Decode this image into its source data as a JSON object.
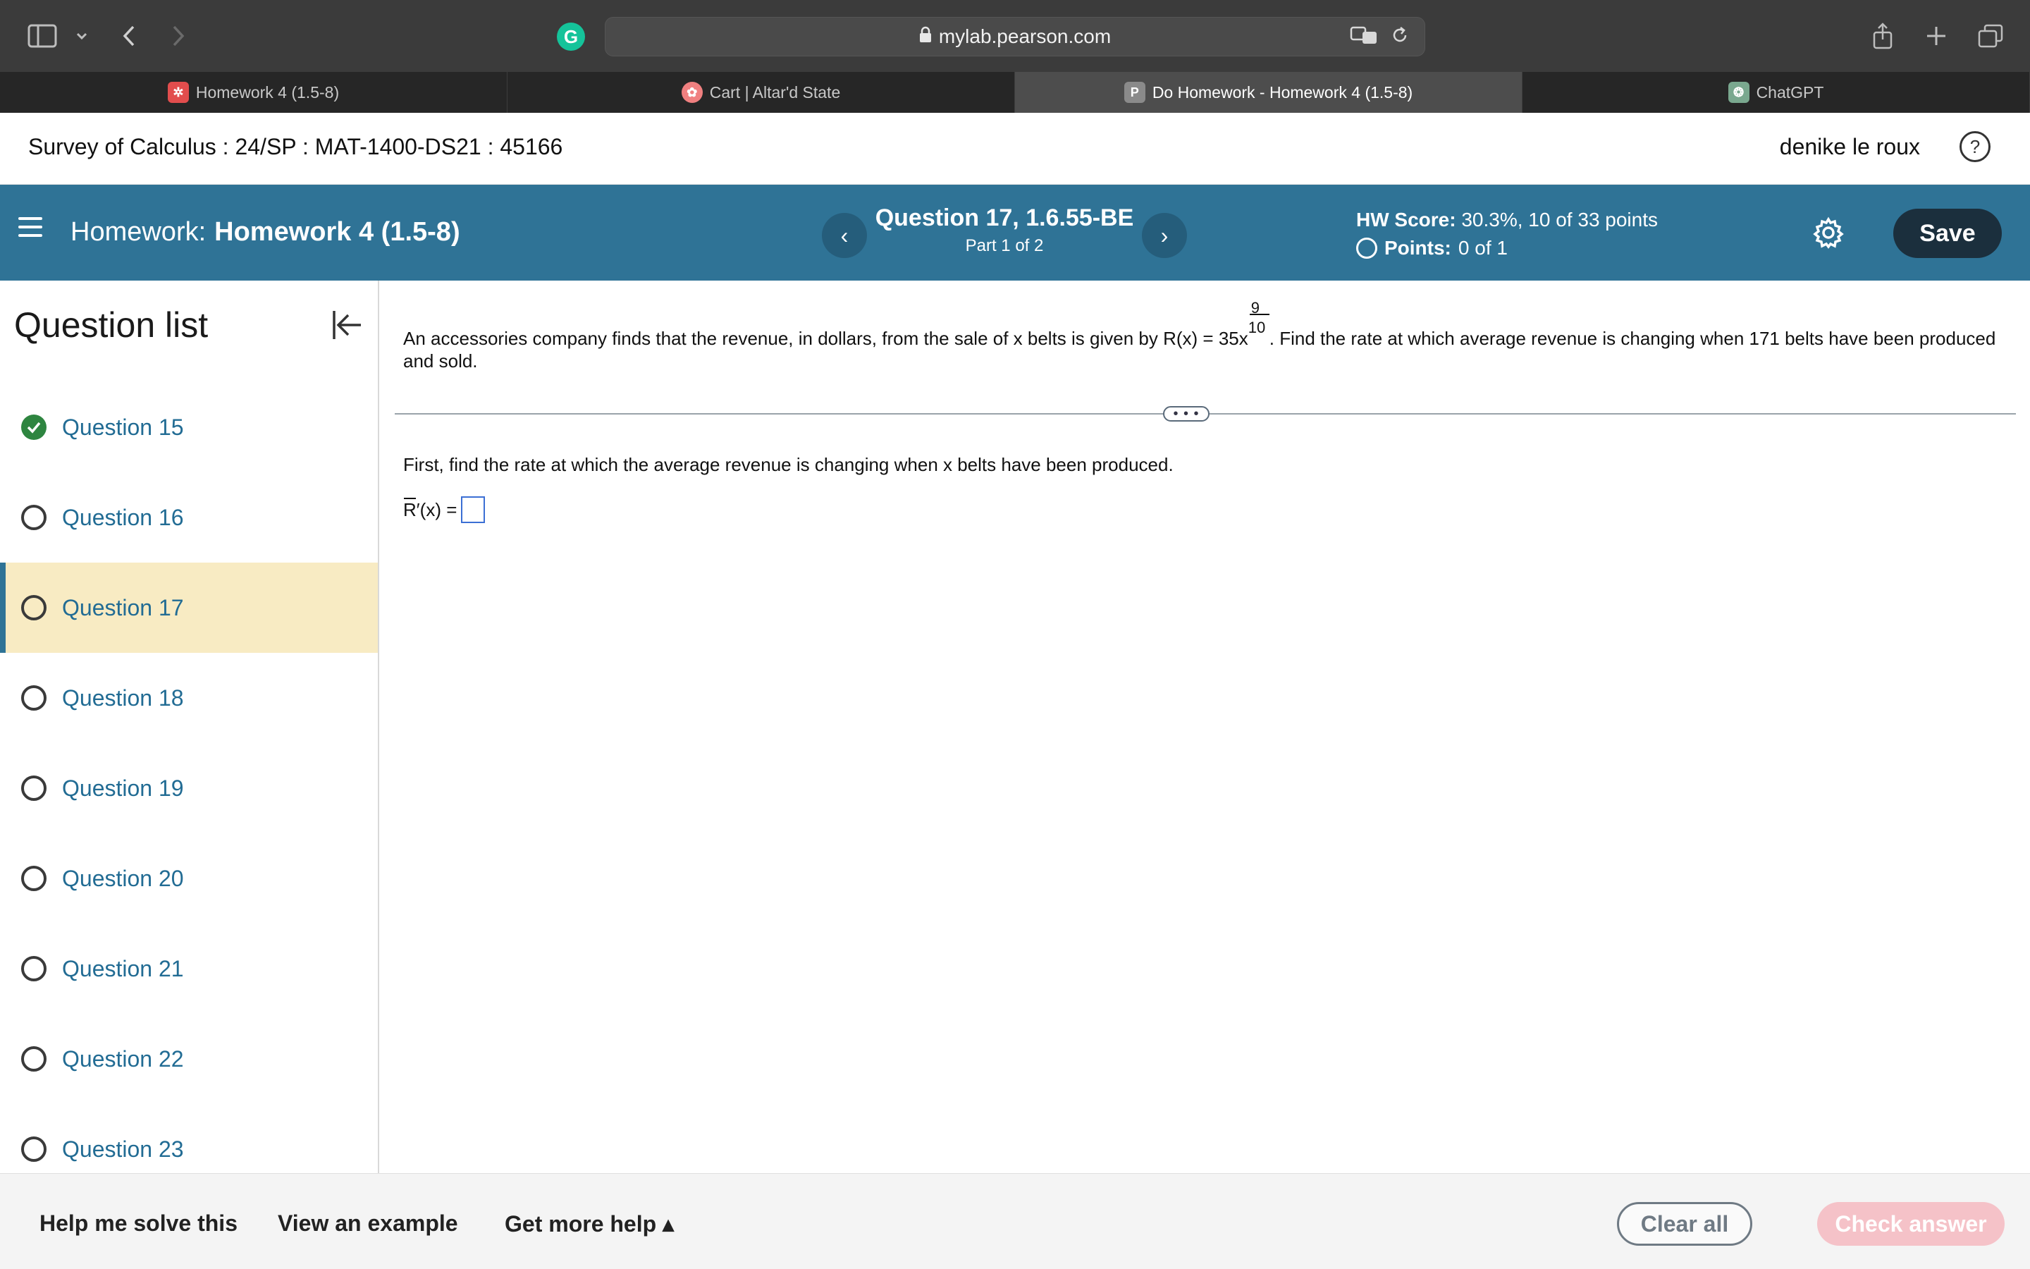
{
  "browser": {
    "url": "mylab.pearson.com",
    "tabs": [
      {
        "label": "Homework 4 (1.5-8)",
        "active": false
      },
      {
        "label": "Cart | Altar'd State",
        "active": false
      },
      {
        "label": "Do Homework - Homework 4 (1.5-8)",
        "active": true
      },
      {
        "label": "ChatGPT",
        "active": false
      }
    ],
    "grammarly_letter": "G",
    "pearson_fav_letter": "P"
  },
  "course": {
    "title": "Survey of Calculus : 24/SP : MAT-1400-DS21 : 45166",
    "user": "denike le roux",
    "help_symbol": "?"
  },
  "homework": {
    "prefix": "Homework:",
    "name": "Homework 4 (1.5-8)",
    "question": "Question 17, 1.6.55-BE",
    "part": "Part 1 of 2",
    "hw_score_label": "HW Score:",
    "hw_score_value": "30.3%, 10 of 33 points",
    "points_label": "Points:",
    "points_value": "0 of 1",
    "save_label": "Save",
    "prev_symbol": "‹",
    "next_symbol": "›"
  },
  "sidebar": {
    "title": "Question list",
    "items": [
      {
        "label": "Question 15",
        "status": "complete"
      },
      {
        "label": "Question 16",
        "status": "incomplete"
      },
      {
        "label": "Question 17",
        "status": "current"
      },
      {
        "label": "Question 18",
        "status": "incomplete"
      },
      {
        "label": "Question 19",
        "status": "incomplete"
      },
      {
        "label": "Question 20",
        "status": "incomplete"
      },
      {
        "label": "Question 21",
        "status": "incomplete"
      },
      {
        "label": "Question 22",
        "status": "incomplete"
      },
      {
        "label": "Question 23",
        "status": "incomplete"
      }
    ]
  },
  "problem": {
    "text_before": "An accessories company finds that the revenue, in dollars, from the sale of x belts is given by R(x) = 35x",
    "exp_num": "9",
    "exp_den": "10",
    "text_after": ". Find the rate at which average revenue is changing when 171 belts have been produced and sold.",
    "expand_dots": "• • •",
    "instruction": "First, find the rate at which the average revenue is changing when x belts have been produced.",
    "answer_label_r": "R",
    "answer_label_rest": "′(x) ="
  },
  "footer": {
    "help_solve": "Help me solve this",
    "view_example": "View an example",
    "more_help": "Get more help ▴",
    "clear_all": "Clear all",
    "check_answer": "Check answer"
  },
  "colors": {
    "accent": "#2f7396",
    "current_question_bg": "#f8ebc3",
    "complete_green": "#2e8540",
    "link_blue": "#226c94",
    "check_button_disabled": "#f5c2c8"
  }
}
